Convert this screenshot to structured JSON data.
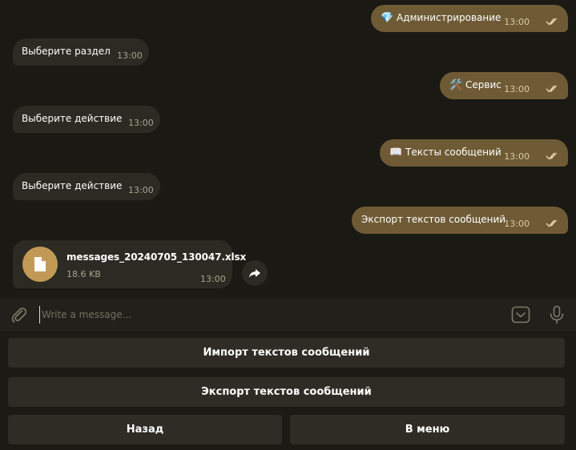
{
  "messages": [
    {
      "dir": "out",
      "emoji": "💎",
      "text": "Администрирование",
      "time": "13:00"
    },
    {
      "dir": "in",
      "text": "Выберите раздел",
      "time": "13:00"
    },
    {
      "dir": "out",
      "emoji": "🛠️",
      "text": "Сервис",
      "time": "13:00"
    },
    {
      "dir": "in",
      "text": "Выберите действие",
      "time": "13:00"
    },
    {
      "dir": "out",
      "emoji": "📖",
      "text": "Тексты сообщений",
      "time": "13:00"
    },
    {
      "dir": "in",
      "text": "Выберите действие",
      "time": "13:00"
    },
    {
      "dir": "out",
      "text": "Экспорт текстов сообщений",
      "time": "13:00"
    }
  ],
  "file": {
    "name": "messages_20240705_130047.xlsx",
    "size": "18.6 KB",
    "time": "13:00",
    "icon": "document-icon"
  },
  "composer": {
    "placeholder": "Write a message...",
    "icons": [
      "paperclip-icon",
      "keyboard-toggle-icon",
      "microphone-icon"
    ]
  },
  "keyboard": {
    "import_label": "Импорт текстов сообщений",
    "export_label": "Экспорт текстов сообщений",
    "back_label": "Назад",
    "menu_label": "В меню"
  },
  "colors": {
    "background": "#1a1914",
    "incoming_bubble": "#2b2a23",
    "outgoing_bubble": "#6e5b35",
    "file_icon": "#c29a55",
    "keyboard_button": "#2e2c24"
  }
}
